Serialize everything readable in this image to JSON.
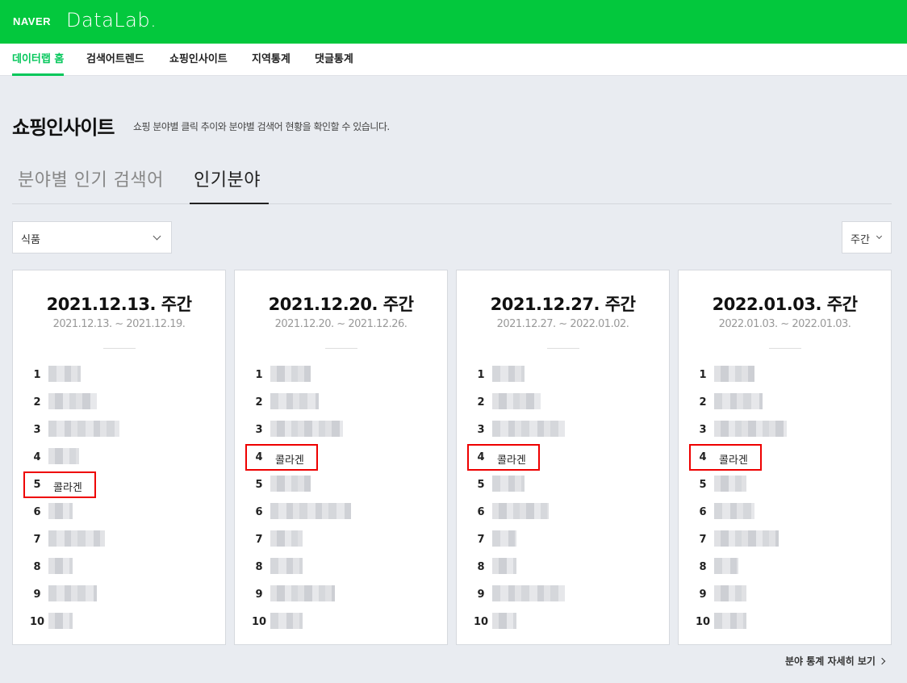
{
  "header": {
    "brand": "NAVER",
    "product": "DataLab."
  },
  "nav": [
    {
      "label": "데이터랩 홈",
      "active": true
    },
    {
      "label": "검색어트렌드",
      "active": false
    },
    {
      "label": "쇼핑인사이트",
      "active": false
    },
    {
      "label": "지역통계",
      "active": false
    },
    {
      "label": "댓글통계",
      "active": false
    }
  ],
  "page": {
    "title": "쇼핑인사이트",
    "description": "쇼핑 분야별 클릭 추이와 분야별 검색어 현황을 확인할 수 있습니다."
  },
  "tabs": [
    {
      "label": "분야별 인기 검색어",
      "active": false
    },
    {
      "label": "인기분야",
      "active": true
    }
  ],
  "filters": {
    "category": "식품",
    "period": "주간"
  },
  "cards": [
    {
      "title": "2021.12.13. 주간",
      "range": "2021.12.13. ~ 2021.12.19.",
      "ranks": [
        "1",
        "2",
        "3",
        "4",
        "5",
        "6",
        "7",
        "8",
        "9",
        "10"
      ],
      "keywords": [
        "",
        "",
        "",
        "",
        "콜라겐",
        "",
        "",
        "",
        "",
        ""
      ],
      "highlight_rank": 5
    },
    {
      "title": "2021.12.20. 주간",
      "range": "2021.12.20. ~ 2021.12.26.",
      "ranks": [
        "1",
        "2",
        "3",
        "4",
        "5",
        "6",
        "7",
        "8",
        "9",
        "10"
      ],
      "keywords": [
        "",
        "",
        "",
        "콜라겐",
        "",
        "",
        "",
        "",
        "",
        ""
      ],
      "highlight_rank": 4
    },
    {
      "title": "2021.12.27. 주간",
      "range": "2021.12.27. ~ 2022.01.02.",
      "ranks": [
        "1",
        "2",
        "3",
        "4",
        "5",
        "6",
        "7",
        "8",
        "9",
        "10"
      ],
      "keywords": [
        "",
        "",
        "",
        "콜라겐",
        "",
        "",
        "",
        "",
        "",
        ""
      ],
      "highlight_rank": 4
    },
    {
      "title": "2022.01.03. 주간",
      "range": "2022.01.03. ~ 2022.01.03.",
      "ranks": [
        "1",
        "2",
        "3",
        "4",
        "5",
        "6",
        "7",
        "8",
        "9",
        "10"
      ],
      "keywords": [
        "",
        "",
        "",
        "콜라겐",
        "",
        "",
        "",
        "",
        "",
        ""
      ],
      "highlight_rank": 4
    }
  ],
  "more_link": "분야 통계 자세히 보기",
  "colors": {
    "brand_green": "#03c83d",
    "active_nav": "#03c75a",
    "highlight": "#e00000"
  }
}
